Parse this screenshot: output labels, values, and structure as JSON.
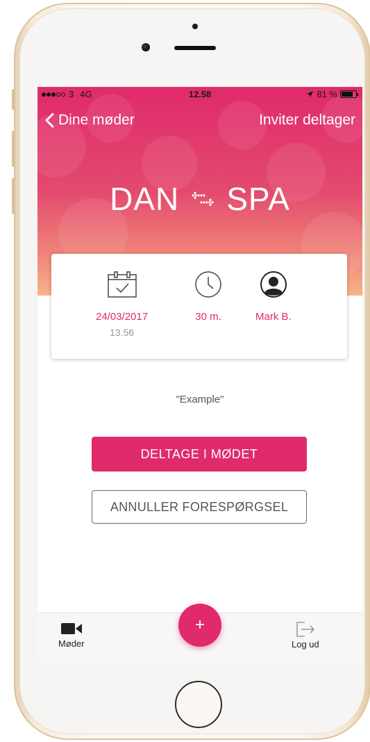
{
  "status_bar": {
    "carrier": "3",
    "network": "4G",
    "time": "12.58",
    "battery_text": "81 %",
    "battery_level": 0.81
  },
  "nav": {
    "back_label": "Dine møder",
    "right_label": "Inviter deltager"
  },
  "route": {
    "from": "DAN",
    "to": "SPA",
    "icon": "swap-arrows-icon"
  },
  "card": {
    "date": "24/03/2017",
    "time": "13.56",
    "duration": "30 m.",
    "person": "Mark B."
  },
  "meeting_name": "\"Example\"",
  "buttons": {
    "join": "DELTAGE I MØDET",
    "cancel": "ANNULLER FORESPØRGSEL"
  },
  "tabbar": {
    "meetings": "Møder",
    "add": "+",
    "logout": "Log ud"
  },
  "colors": {
    "accent": "#e02a6c",
    "gradient_bottom": "#f7b48a"
  }
}
